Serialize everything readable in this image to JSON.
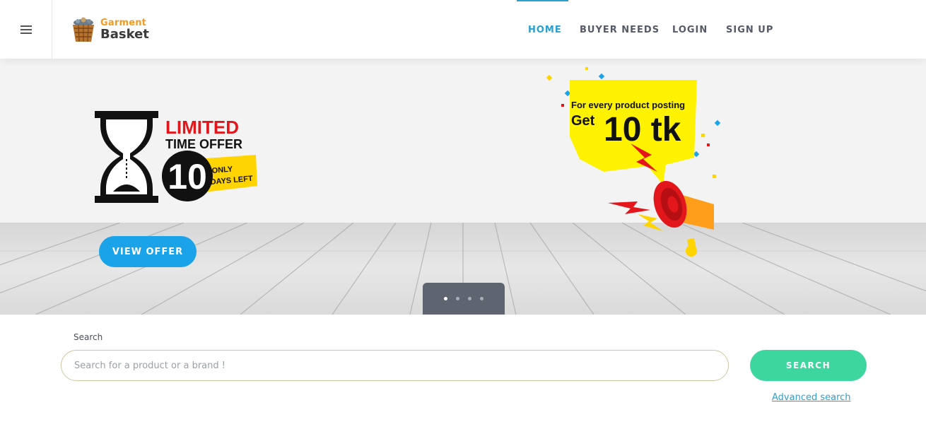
{
  "header": {
    "logo": {
      "line1": "Garment",
      "line2": "Basket"
    },
    "nav": [
      {
        "label": "HOME",
        "active": true
      },
      {
        "label": "BUYER NEEDS",
        "active": false
      },
      {
        "label": "LOGIN",
        "active": false
      },
      {
        "label": "SIGN UP",
        "active": false
      }
    ],
    "menu_icon": "hamburger-icon"
  },
  "hero": {
    "offer_badge": {
      "line1": "LIMITED",
      "line2": "TIME OFFER",
      "number": "10",
      "tag_line1": "ONLY",
      "tag_line2": "DAYS LEFT",
      "icon": "hourglass-icon"
    },
    "promo": {
      "line1": "For every product posting",
      "line2_prefix": "Get",
      "amount": "10 tk",
      "icon": "megaphone-icon"
    },
    "view_offer_label": "VIEW OFFER",
    "slides": {
      "count": 4,
      "active_index": 0
    }
  },
  "search": {
    "label": "Search",
    "placeholder": "Search for a product or a brand !",
    "value": "",
    "button_label": "SEARCH",
    "advanced_label": "Advanced search"
  },
  "colors": {
    "accent_blue": "#2a9fd0",
    "button_blue": "#1aa3e8",
    "search_green": "#3cd69e",
    "logo_orange": "#f39a1f",
    "promo_yellow": "#fff200",
    "badge_red": "#e3161b"
  }
}
